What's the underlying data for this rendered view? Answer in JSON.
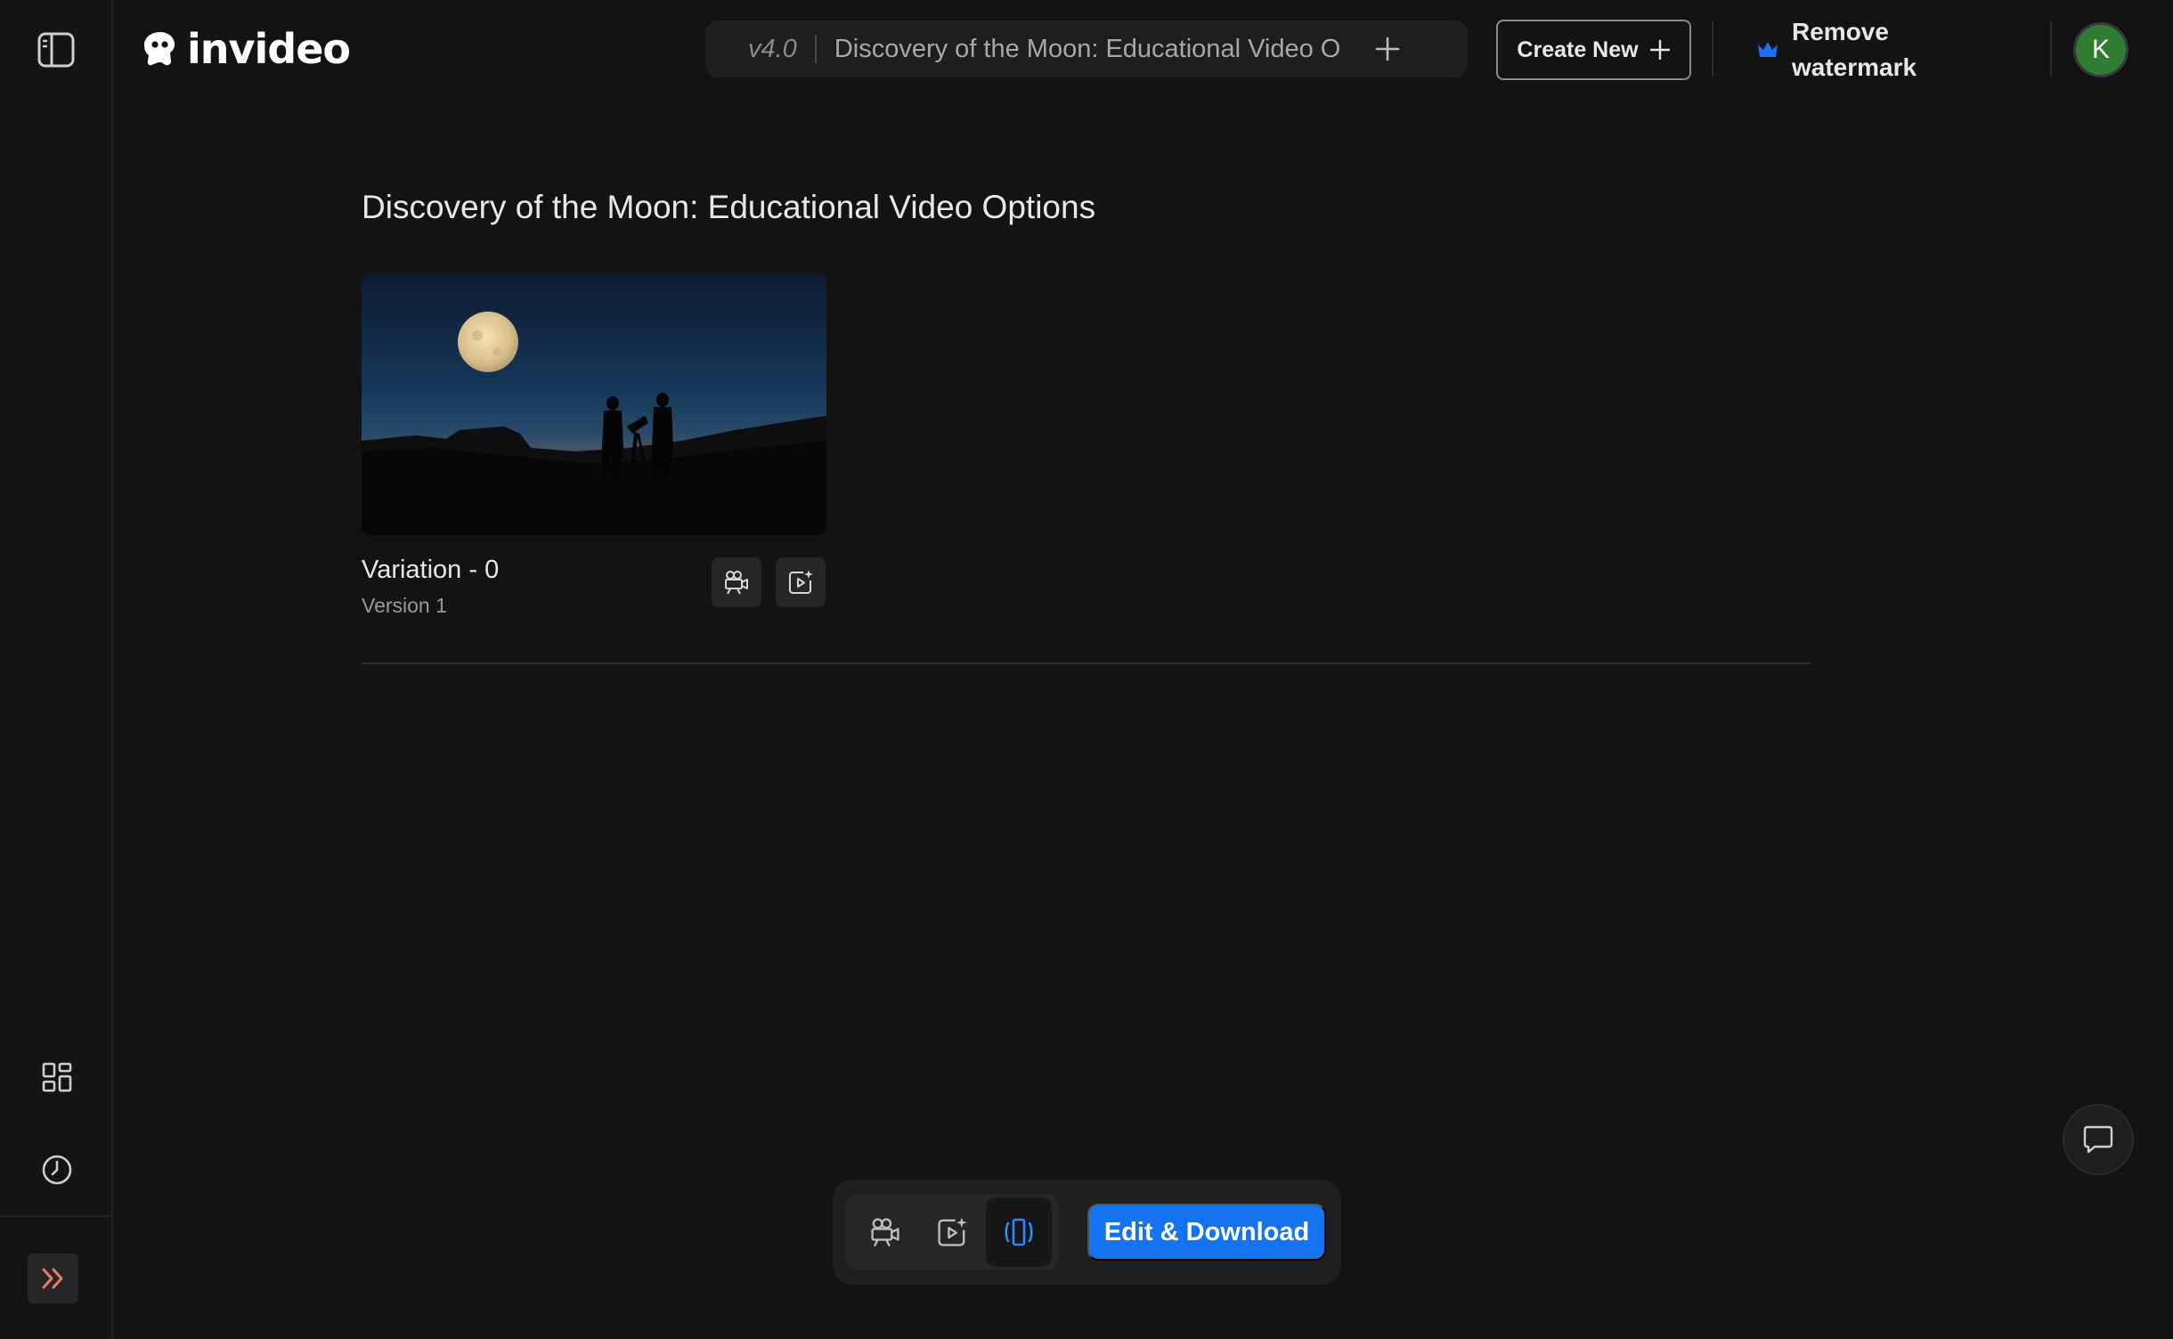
{
  "app": {
    "logo_text": "invideo"
  },
  "project_bar": {
    "version": "v4.0",
    "title": "Discovery of the Moon: Educational Video Options"
  },
  "header": {
    "create_new_label": "Create New",
    "remove_watermark_label": "Remove watermark",
    "avatar_initial": "K"
  },
  "page": {
    "title": "Discovery of the Moon: Educational Video Options"
  },
  "variations": [
    {
      "name": "Variation - 0",
      "version": "Version 1"
    }
  ],
  "toolbar": {
    "edit_download_label": "Edit & Download"
  },
  "colors": {
    "background": "#131313",
    "accent": "#1474f0",
    "avatar": "#2e7d32",
    "expand_icon": "#f07a6a"
  },
  "icons": {
    "sidebar_toggle": "sidebar-panel-icon",
    "templates": "grid-icon",
    "history": "clock-icon",
    "expand": "chevrons-right-icon",
    "crown": "crown-icon",
    "chat": "chat-icon"
  }
}
